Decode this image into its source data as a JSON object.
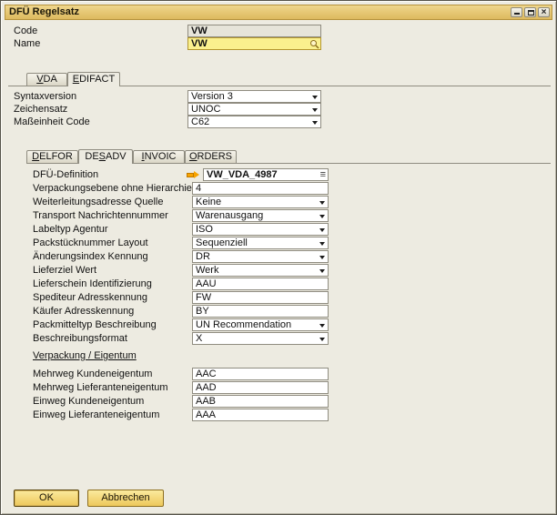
{
  "window": {
    "title": "DFÜ Regelsatz"
  },
  "icons": {
    "close": "×",
    "choose_list": "≡"
  },
  "header": {
    "code": {
      "label": "Code",
      "value": "VW"
    },
    "name": {
      "label": "Name",
      "value": "VW"
    }
  },
  "tabs": [
    {
      "pre": "",
      "accel": "V",
      "post": "DA"
    },
    {
      "pre": "",
      "accel": "E",
      "post": "DIFACT"
    }
  ],
  "edifact": [
    {
      "label": "Syntaxversion",
      "value": "Version 3"
    },
    {
      "label": "Zeichensatz",
      "value": "UNOC"
    },
    {
      "label": "Maßeinheit Code",
      "value": "C62"
    }
  ],
  "subtabs": [
    {
      "pre": "",
      "accel": "D",
      "post": "ELFOR"
    },
    {
      "pre": "DE",
      "accel": "S",
      "post": "ADV"
    },
    {
      "pre": "",
      "accel": "I",
      "post": "NVOIC"
    },
    {
      "pre": "",
      "accel": "O",
      "post": "RDERS"
    }
  ],
  "desadv": [
    {
      "label": "DFÜ-Definition",
      "value": "VW_VDA_4987"
    },
    {
      "label": "Verpackungsebene ohne Hierarchie",
      "value": "4"
    },
    {
      "label": "Weiterleitungsadresse Quelle",
      "value": "Keine"
    },
    {
      "label": "Transport Nachrichtennummer",
      "value": "Warenausgang"
    },
    {
      "label": "Labeltyp Agentur",
      "value": "ISO"
    },
    {
      "label": "Packstücknummer Layout",
      "value": "Sequenziell"
    },
    {
      "label": "Änderungsindex Kennung",
      "value": "DR"
    },
    {
      "label": "Lieferziel Wert",
      "value": "Werk"
    },
    {
      "label": "Lieferschein Identifizierung",
      "value": "AAU"
    },
    {
      "label": "Spediteur Adresskennung",
      "value": "FW"
    },
    {
      "label": "Käufer Adresskennung",
      "value": "BY"
    },
    {
      "label": "Packmitteltyp Beschreibung",
      "value": "UN Recommendation"
    },
    {
      "label": "Beschreibungsformat",
      "value": "X"
    }
  ],
  "section_title": "Verpackung / Eigentum",
  "packaging": [
    {
      "label": "Mehrweg Kundeneigentum",
      "value": "AAC"
    },
    {
      "label": "Mehrweg Lieferanteneigentum",
      "value": "AAD"
    },
    {
      "label": "Einweg Kundeneigentum",
      "value": "AAB"
    },
    {
      "label": "Einweg Lieferanteneigentum",
      "value": "AAA"
    }
  ],
  "buttons": {
    "ok": "OK",
    "cancel": "Abbrechen"
  }
}
